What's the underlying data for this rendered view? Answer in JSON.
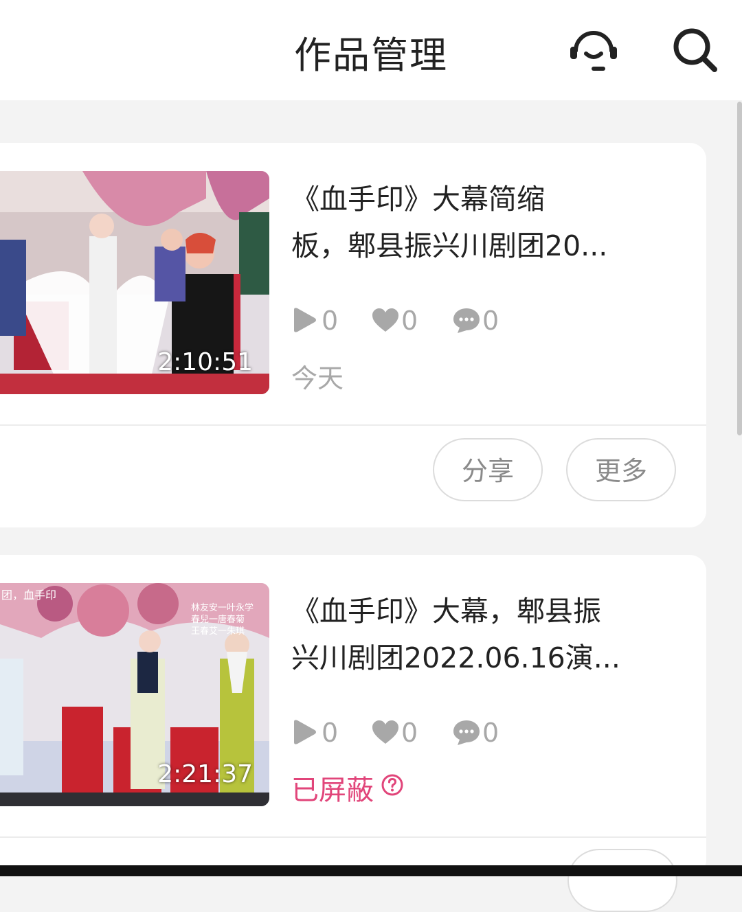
{
  "header": {
    "title": "作品管理",
    "icons": [
      "customer-service-icon",
      "search-icon"
    ]
  },
  "videos": [
    {
      "title_line1": "《血手印》大幕简缩",
      "title_line2": "板，郫县振兴川剧团20...",
      "duration": "2:10:51",
      "plays": "0",
      "likes": "0",
      "comments": "0",
      "date": "今天",
      "share_label": "分享",
      "more_label": "更多"
    },
    {
      "title_line1": "《血手印》大幕，郫县振",
      "title_line2": "兴川剧团2022.06.16演...",
      "duration": "2:21:37",
      "plays": "0",
      "likes": "0",
      "comments": "0",
      "status": "已屏蔽",
      "overlay_text_left": "团，血手印",
      "overlay_cast_1": "林友安一叶永学",
      "overlay_cast_2": "春兒一唐春菊",
      "overlay_cast_3": "王春艾一朱琪"
    }
  ],
  "colors": {
    "blocked": "#e1457a",
    "muted": "#a8a8a8",
    "background": "#f3f3f3"
  }
}
